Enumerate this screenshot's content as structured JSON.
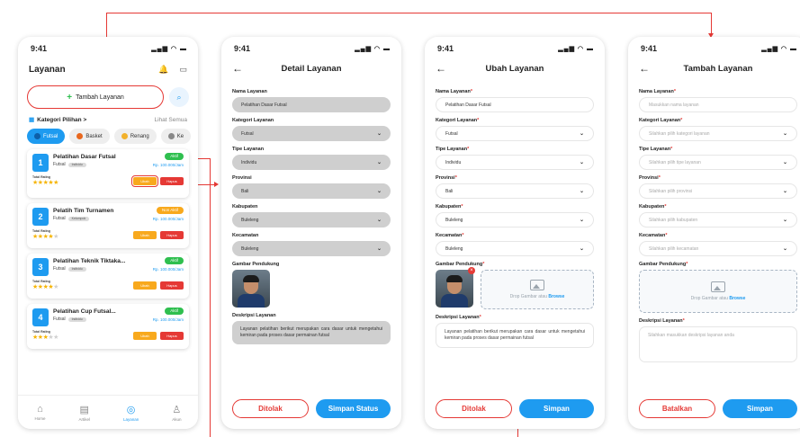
{
  "status_time": "9:41",
  "list_screen": {
    "title": "Layanan",
    "add_button": "Tambah Layanan",
    "category_title": "Kategori Pilihan >",
    "see_all": "Lihat Semua",
    "chips": [
      "Futsal",
      "Basket",
      "Renang",
      "Ke"
    ],
    "cards": [
      {
        "num": "1",
        "title": "Pelatihan Dasar Futsal",
        "sport": "Futsal",
        "tag": "Individu",
        "status": "Aktif",
        "status_color": "#2fbf4f",
        "price": "Rp. 100.000/Jam",
        "rating_label": "Total Rating",
        "stars": 5,
        "edit": "Ubah",
        "delete": "Hapus"
      },
      {
        "num": "2",
        "title": "Pelatih Tim Turnamen",
        "sport": "Futsal",
        "tag": "Kelompok",
        "status": "Non Aktif",
        "status_color": "#f8a91d",
        "price": "Rp. 100.000/Jam",
        "rating_label": "Total Rating",
        "stars": 4,
        "edit": "Ubah",
        "delete": "Hapus"
      },
      {
        "num": "3",
        "title": "Pelatihan Teknik Tiktaka...",
        "sport": "Futsal",
        "tag": "Individu",
        "status": "Aktif",
        "status_color": "#2fbf4f",
        "price": "Rp. 100.000/Jam",
        "rating_label": "Total Rating",
        "stars": 4,
        "edit": "Ubah",
        "delete": "Hapus"
      },
      {
        "num": "4",
        "title": "Pelatihan Cup Futsal...",
        "sport": "Futsal",
        "tag": "Individu",
        "status": "Aktif",
        "status_color": "#2fbf4f",
        "price": "Rp. 100.000/Jam",
        "rating_label": "Total Rating",
        "stars": 3,
        "edit": "Ubah",
        "delete": "Hapus"
      }
    ],
    "tabs": [
      {
        "label": "Home",
        "icon": "home-icon"
      },
      {
        "label": "Artikel",
        "icon": "article-icon"
      },
      {
        "label": "Layanan",
        "icon": "service-icon"
      },
      {
        "label": "Akun",
        "icon": "user-icon"
      }
    ]
  },
  "detail_screen": {
    "title": "Detail Layanan",
    "labels": {
      "name": "Nama Layanan",
      "category": "Kategori Layanan",
      "type": "Tipe Layanan",
      "province": "Provinsi",
      "regency": "Kabupaten",
      "district": "Kecamatan",
      "photo": "Gambar Pendukung",
      "description": "Deskripsi Layanan"
    },
    "values": {
      "name": "Pelatihan Dasar Futsal",
      "category": "Futsal",
      "type": "Individu",
      "province": "Bali",
      "regency": "Buleleng",
      "district": "Buleleng",
      "description": "Layanan pelatihan berikut merupakan cara dasar untuk mengetahui kemiran pada proses dasar permainan futsal"
    },
    "reject": "Ditolak",
    "save_status": "Simpan Status"
  },
  "edit_screen": {
    "title": "Ubah Layanan",
    "labels": {
      "name": "Nama Layanan",
      "category": "Kategori Layanan",
      "type": "Tipe Layanan",
      "province": "Provinsi",
      "regency": "Kabupaten",
      "district": "Kecamatan",
      "photo": "Gambar Pendukung",
      "description": "Deskripsi Layanan"
    },
    "values": {
      "name": "Pelatihan Dasar Futsal",
      "category": "Futsal",
      "type": "Individu",
      "province": "Bali",
      "regency": "Buleleng",
      "district": "Buleleng",
      "description": "Layanan pelatihan berikut merupakan cara dasar untuk mengetahui kemiran pada proses dasar permainan futsal"
    },
    "drop_text": "Drop Gambar atau",
    "browse": "Browse",
    "reject": "Ditolak",
    "save": "Simpan"
  },
  "add_screen": {
    "title": "Tambah Layanan",
    "labels": {
      "name": "Nama Layanan",
      "category": "Kategori Layanan",
      "type": "Tipe Layanan",
      "province": "Provinsi",
      "regency": "Kabupaten",
      "district": "Kecamatan",
      "photo": "Gambar Pendukung",
      "description": "Deskripsi Layanan"
    },
    "placeholders": {
      "name": "Masukkan nama layanan",
      "category": "Silahkan pilih kategori layanan",
      "type": "Silahkan pilih tipe layanan",
      "province": "Silahkan pilih provinsi",
      "regency": "Silahkan pilih kabupaten",
      "district": "Silahkan pilih kecamatan",
      "description": "Silahkan masukkan deskripsi layanan anda"
    },
    "drop_text": "Drop Gambar atau",
    "browse": "Browse",
    "cancel": "Batalkan",
    "save": "Simpan"
  }
}
